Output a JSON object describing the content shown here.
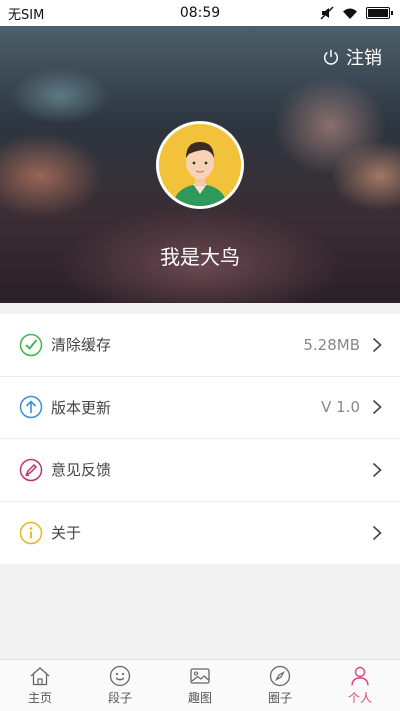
{
  "status_bar": {
    "carrier": "无SIM",
    "time": "08:59"
  },
  "header": {
    "logout_label": "注销",
    "username": "我是大鸟"
  },
  "menu": [
    {
      "label": "清除缓存",
      "value": "5.28MB",
      "icon": "clear-cache-icon",
      "color": "#3bb54a"
    },
    {
      "label": "版本更新",
      "value": "V 1.0",
      "icon": "update-icon",
      "color": "#3a8fd8"
    },
    {
      "label": "意见反馈",
      "value": "",
      "icon": "feedback-icon",
      "color": "#c2336b"
    },
    {
      "label": "关于",
      "value": "",
      "icon": "about-icon",
      "color": "#e8b51a"
    }
  ],
  "tabs": [
    {
      "label": "主页",
      "icon": "home-icon",
      "active": false
    },
    {
      "label": "段子",
      "icon": "smile-icon",
      "active": false
    },
    {
      "label": "趣图",
      "icon": "image-icon",
      "active": false
    },
    {
      "label": "圈子",
      "icon": "compass-icon",
      "active": false
    },
    {
      "label": "个人",
      "icon": "person-icon",
      "active": true
    }
  ],
  "colors": {
    "accent": "#d9457a"
  }
}
